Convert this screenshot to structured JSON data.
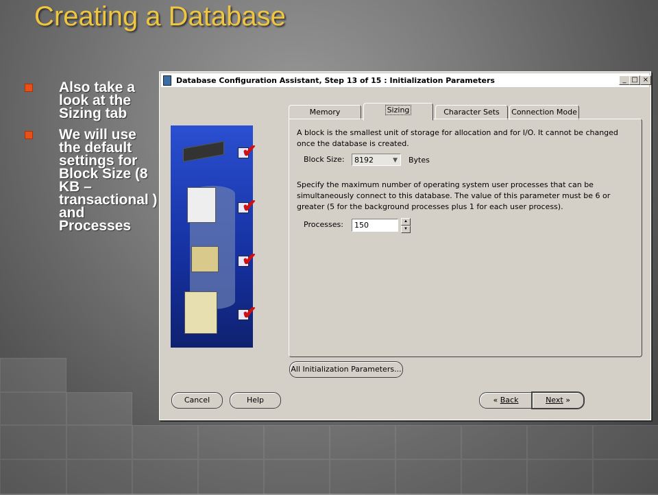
{
  "slide": {
    "title": "Creating a Database",
    "bullets": [
      "Also take a look at the Sizing tab",
      "We will use the default settings for Block Size (8 KB – transactional ) and Processes"
    ]
  },
  "window": {
    "title": "Database Configuration Assistant, Step 13 of 15 : Initialization Parameters",
    "controls": {
      "minimize": "_",
      "maximize": "□",
      "close": "×"
    }
  },
  "tabs": [
    {
      "label": "Memory"
    },
    {
      "label": "Sizing"
    },
    {
      "label": "Character Sets"
    },
    {
      "label": "Connection Mode"
    }
  ],
  "sizing": {
    "block_description": "A block is the smallest unit of storage for allocation and for I/O. It cannot be changed once the database is created.",
    "block_size_label": "Block Size:",
    "block_size_value": "8192",
    "block_size_unit": "Bytes",
    "processes_description": "Specify the maximum number of operating system user processes that can be simultaneously connect to this database. The value of this parameter must be 6 or greater (5 for the background processes plus 1 for each user process).",
    "processes_label": "Processes:",
    "processes_value": "150"
  },
  "buttons": {
    "all_params": "All Initialization Parameters...",
    "cancel": "Cancel",
    "help": "Help",
    "back": "Back",
    "next": "Next"
  }
}
